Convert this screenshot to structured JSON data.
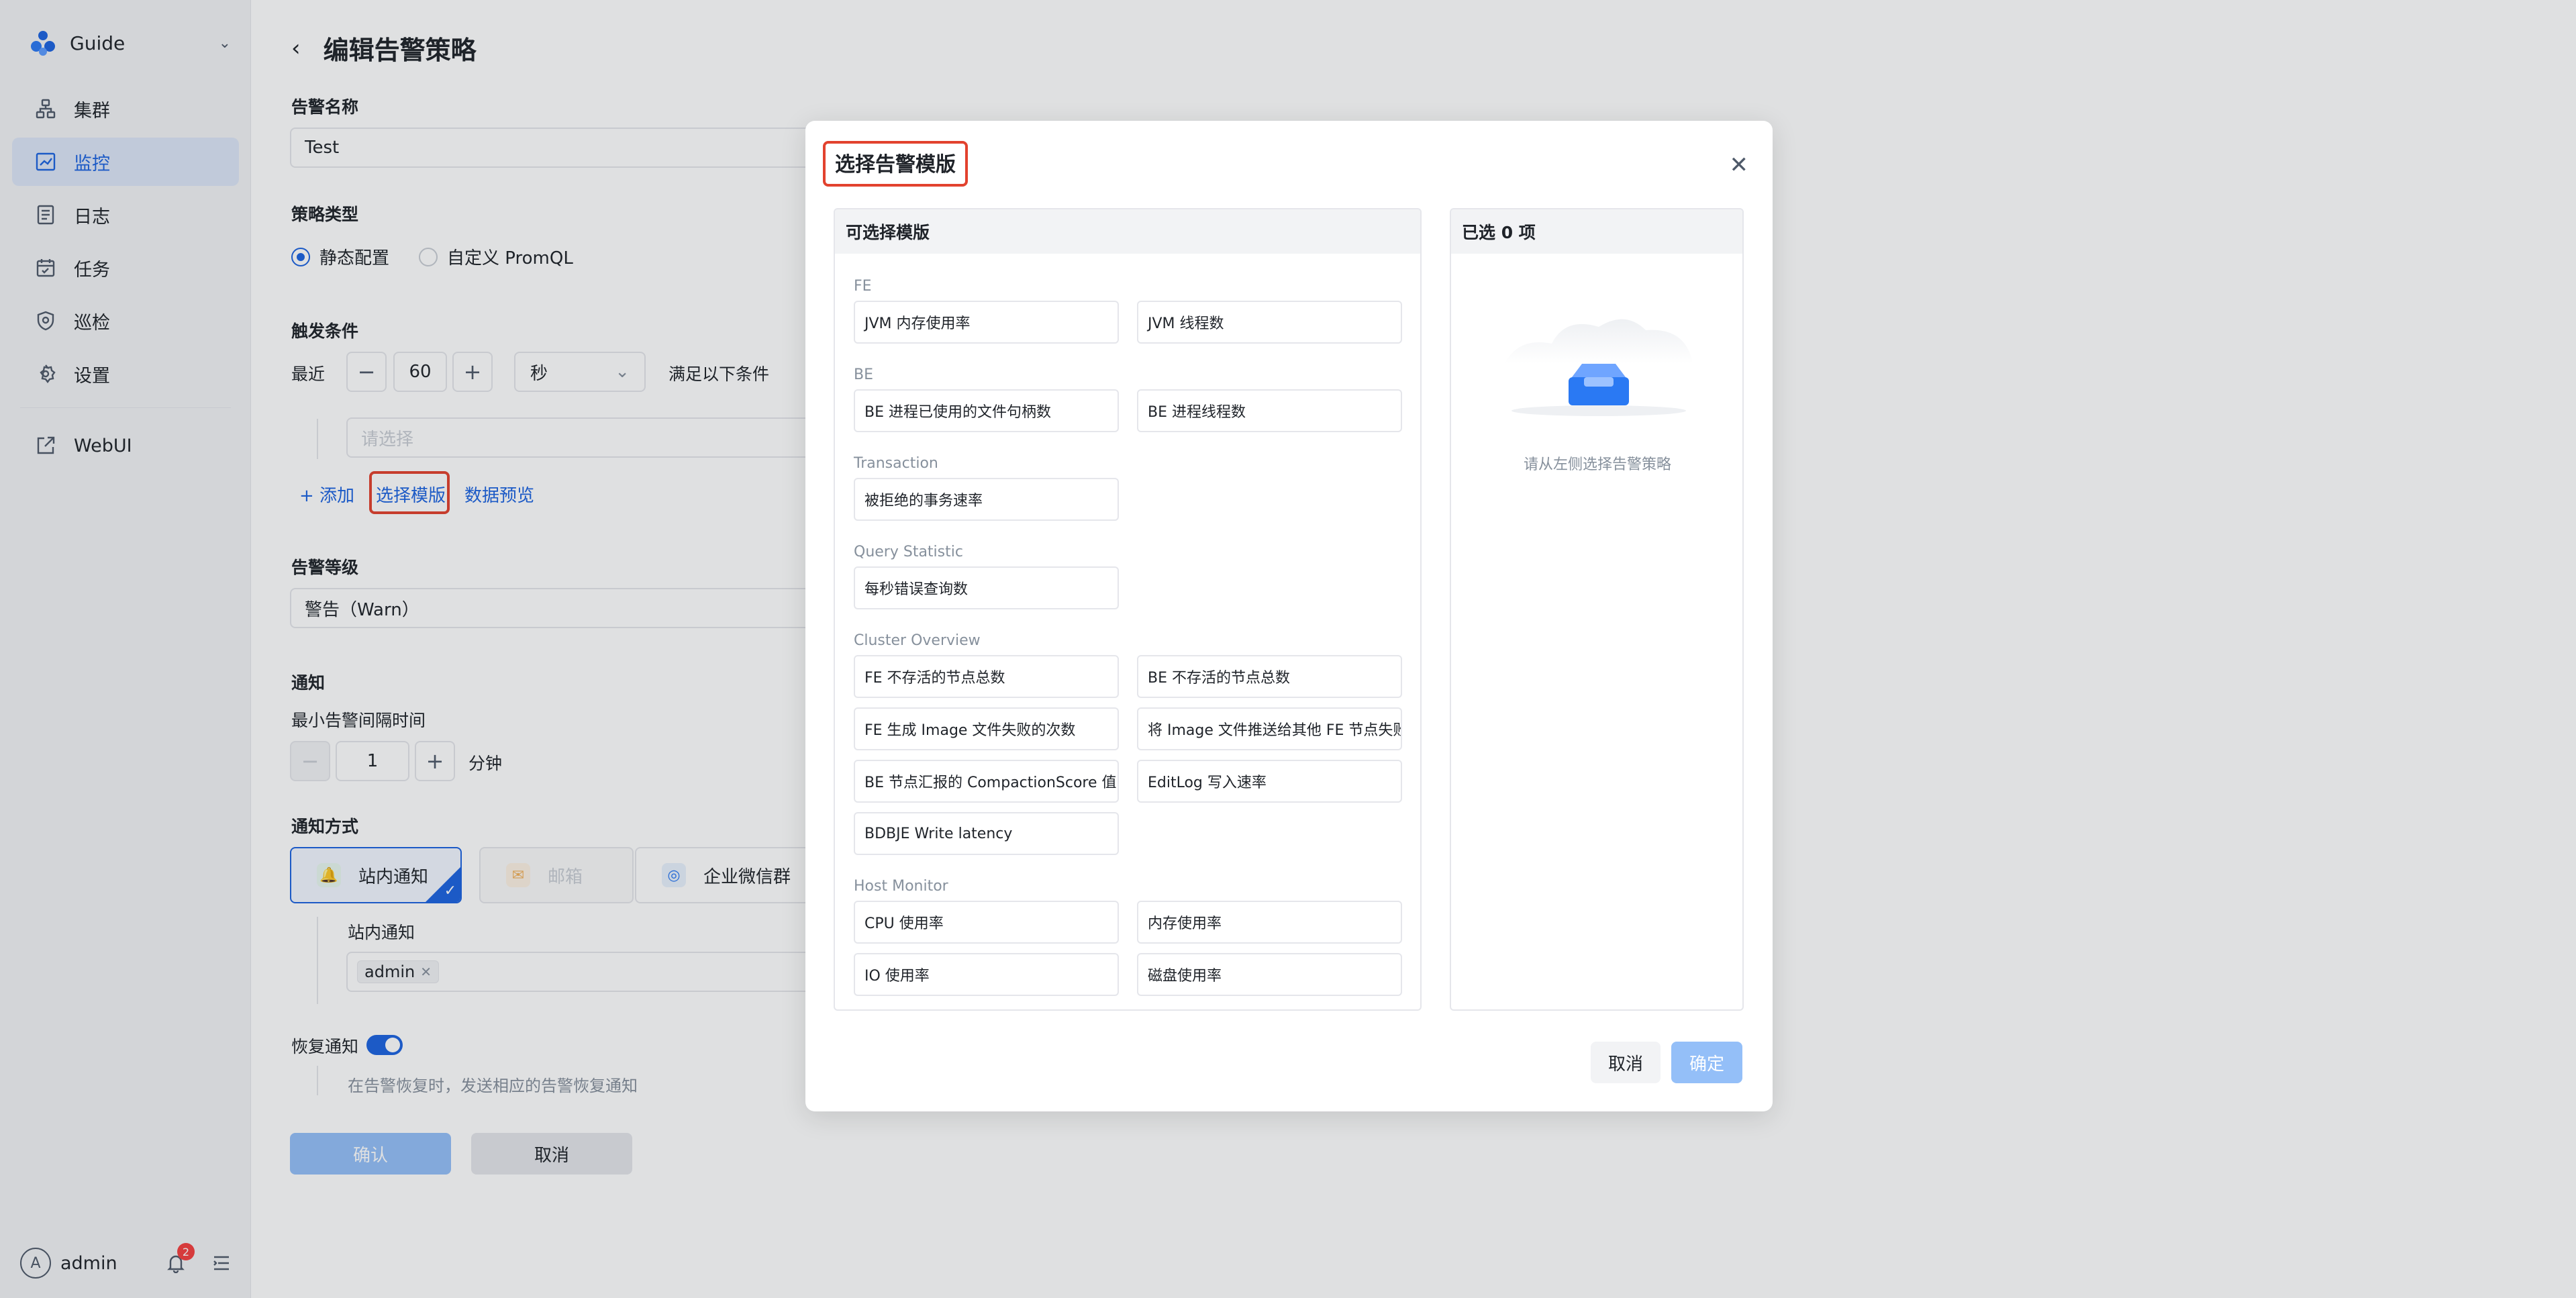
{
  "sidebar": {
    "brand": "Guide",
    "items": [
      {
        "label": "集群",
        "icon": "cluster-icon"
      },
      {
        "label": "监控",
        "icon": "monitor-chart-icon",
        "active": true
      },
      {
        "label": "日志",
        "icon": "log-document-icon"
      },
      {
        "label": "任务",
        "icon": "task-calendar-icon"
      },
      {
        "label": "巡检",
        "icon": "shield-icon"
      },
      {
        "label": "设置",
        "icon": "gear-icon"
      }
    ],
    "webui": "WebUI",
    "user": {
      "avatar_letter": "A",
      "name": "admin",
      "notification_count": "2"
    }
  },
  "form": {
    "page_title": "编辑告警策略",
    "alert_name_label": "告警名称",
    "alert_name_value": "Test",
    "policy_type_label": "策略类型",
    "policy_type_options": [
      "静态配置",
      "自定义 PromQL"
    ],
    "trigger_label": "触发条件",
    "recent_label": "最近",
    "recent_value": "60",
    "time_unit": "秒",
    "condition_suffix": "满足以下条件",
    "condition_placeholder": "请选择",
    "add_link": "+ 添加",
    "select_template_link": "选择模版",
    "data_preview_link": "数据预览",
    "level_label": "告警等级",
    "level_value": "警告（Warn）",
    "notify_label": "通知",
    "min_interval_label": "最小告警间隔时间",
    "min_interval_value": "1",
    "min_interval_unit": "分钟",
    "notify_method_label": "通知方式",
    "notify_methods": [
      "站内通知",
      "邮箱",
      "企业微信群"
    ],
    "inapp_label": "站内通知",
    "inapp_tag": "admin",
    "recovery_label": "恢复通知",
    "recovery_hint": "在告警恢复时，发送相应的告警恢复通知",
    "confirm": "确认",
    "cancel": "取消"
  },
  "modal": {
    "title": "选择告警模版",
    "left_header": "可选择模版",
    "right_header": "已选 0 项",
    "empty_text": "请从左侧选择告警策略",
    "groups": [
      {
        "name": "FE",
        "items": [
          "JVM 内存使用率",
          "JVM 线程数"
        ]
      },
      {
        "name": "BE",
        "items": [
          "BE 进程已使用的文件句柄数",
          "BE 进程线程数"
        ]
      },
      {
        "name": "Transaction",
        "items": [
          "被拒绝的事务速率"
        ]
      },
      {
        "name": "Query Statistic",
        "items": [
          "每秒错误查询数"
        ]
      },
      {
        "name": "Cluster Overview",
        "items": [
          "FE 不存活的节点总数",
          "BE 不存活的节点总数",
          "FE 生成 Image 文件失败的次数",
          "将 Image 文件推送给其他 FE 节点失败的次数",
          "BE 节点汇报的 CompactionScore 值",
          "EditLog 写入速率",
          "BDBJE Write latency"
        ]
      },
      {
        "name": "Host Monitor",
        "items": [
          "CPU 使用率",
          "内存使用率",
          "IO 使用率",
          "磁盘使用率"
        ]
      }
    ],
    "cancel": "取消",
    "ok": "确定"
  },
  "colors": {
    "accent": "#1d63e0",
    "highlight": "#e2422e",
    "disabled_primary": "#94bff8"
  }
}
